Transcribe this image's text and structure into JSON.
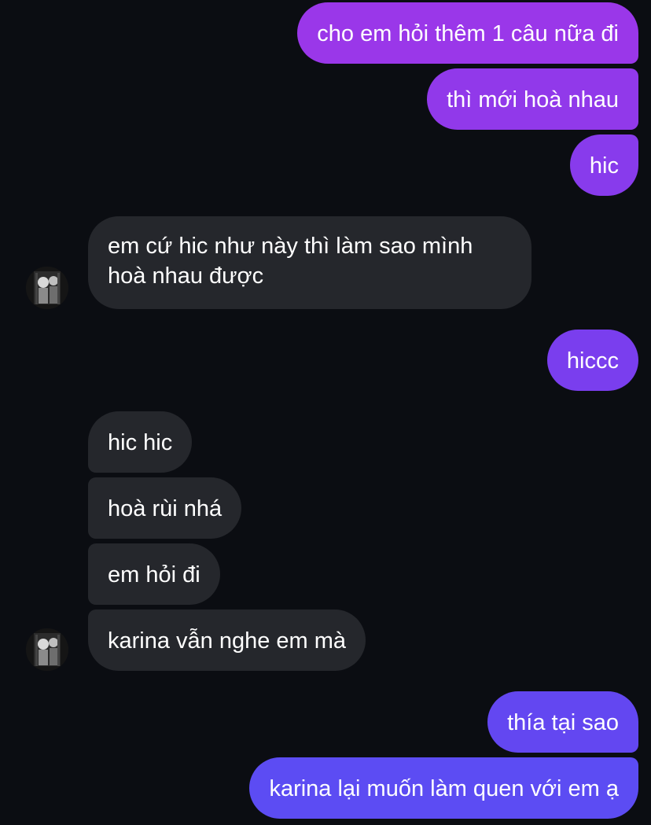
{
  "colors": {
    "background": "#0b0d12",
    "incoming_bubble": "#25272c",
    "outgoing_gradient_top": "#9a37e9",
    "outgoing_gradient_bottom": "#5c4cf3"
  },
  "messages": [
    {
      "direction": "outgoing",
      "text": "cho em hỏi thêm 1 câu nữa đi"
    },
    {
      "direction": "outgoing",
      "text": "thì mới hoà nhau"
    },
    {
      "direction": "outgoing",
      "text": "hic"
    },
    {
      "direction": "incoming",
      "text": "em cứ hic như này thì làm sao mình hoà nhau được"
    },
    {
      "direction": "outgoing",
      "text": "hiccc"
    },
    {
      "direction": "incoming",
      "text": "hic hic"
    },
    {
      "direction": "incoming",
      "text": "hoà rùi nhá"
    },
    {
      "direction": "incoming",
      "text": "em hỏi đi"
    },
    {
      "direction": "incoming",
      "text": "karina vẫn nghe em mà"
    },
    {
      "direction": "outgoing",
      "text": "thía tại sao"
    },
    {
      "direction": "outgoing",
      "text": "karina lại muốn làm quen với em ạ"
    }
  ],
  "avatars": [
    {
      "icon": "contact-avatar-icon"
    },
    {
      "icon": "contact-avatar-icon"
    }
  ]
}
